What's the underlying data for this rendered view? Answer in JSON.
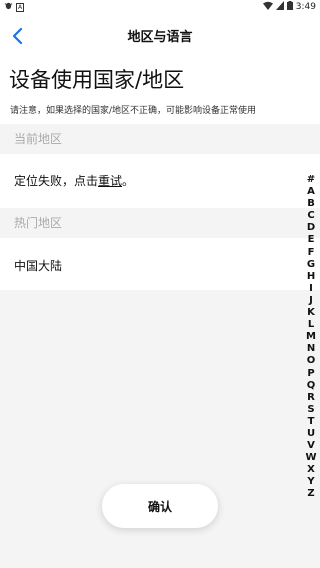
{
  "status_bar": {
    "left_icons": [
      "bug-icon",
      "a-box-icon"
    ],
    "time": "3:49"
  },
  "nav": {
    "title": "地区与语言",
    "back_icon": "chevron-left-icon",
    "accent_color": "#1a73e8"
  },
  "header": {
    "title": "设备使用国家/地区",
    "notice": "请注意，如果选择的国家/地区不正确，可能影响设备正常使用"
  },
  "current_region": {
    "label": "当前地区",
    "status_prefix": "定位失败，点击",
    "retry_label": "重试",
    "status_suffix": "。"
  },
  "popular_regions": {
    "label": "热门地区",
    "items": [
      "中国大陆"
    ]
  },
  "index_letters": [
    "#",
    "A",
    "B",
    "C",
    "D",
    "E",
    "F",
    "G",
    "H",
    "I",
    "J",
    "K",
    "L",
    "M",
    "N",
    "O",
    "P",
    "Q",
    "R",
    "S",
    "T",
    "U",
    "V",
    "W",
    "X",
    "Y",
    "Z"
  ],
  "confirm_label": "确认"
}
